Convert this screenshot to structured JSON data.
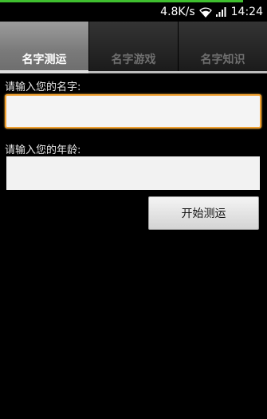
{
  "status_bar": {
    "network_speed": "4.8K/s",
    "time": "14:24",
    "icons": [
      "wifi-icon",
      "signal-icon"
    ],
    "accent_color": "#3fbf2f"
  },
  "tabs": [
    {
      "label": "名字测运",
      "active": true
    },
    {
      "label": "名字游戏",
      "active": false
    },
    {
      "label": "名字知识",
      "active": false
    }
  ],
  "form": {
    "name_label": "请输入您的名字:",
    "name_value": "",
    "age_label": "请输入您的年龄:",
    "age_value": "",
    "submit_label": "开始测运",
    "focus_color": "#f0a030"
  }
}
